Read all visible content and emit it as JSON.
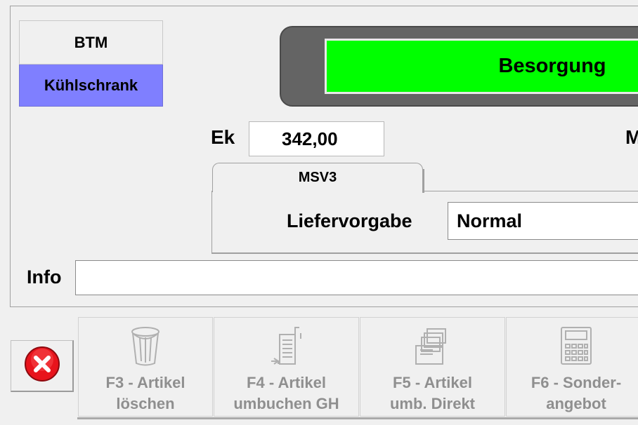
{
  "flags": {
    "btm": "BTM",
    "kuehlschrank": "Kühlschrank"
  },
  "status": {
    "text": "Besorgung",
    "color": "#00ff00"
  },
  "price": {
    "label": "Ek",
    "value": "342,00",
    "next_label_partial": "M"
  },
  "tabs": [
    {
      "label": "MSV3"
    }
  ],
  "msv3": {
    "liefervorgabe_label": "Liefervorgabe",
    "liefervorgabe_value": "Normal"
  },
  "info": {
    "label": "Info",
    "value": ""
  },
  "toolbar": {
    "cancel_icon": "close-circle-icon",
    "buttons": [
      {
        "key": "f3",
        "label": "F3 - Artikel\nlöschen",
        "icon": "trash-icon",
        "enabled": false
      },
      {
        "key": "f4",
        "label": "F4 - Artikel\numbuchen GH",
        "icon": "document-transfer-icon",
        "enabled": false
      },
      {
        "key": "f5",
        "label": "F5 - Artikel\numb. Direkt",
        "icon": "stacked-documents-icon",
        "enabled": false
      },
      {
        "key": "f6",
        "label": "F6 - Sonder-\nangebot",
        "icon": "calculator-icon",
        "enabled": false
      }
    ]
  },
  "colors": {
    "kuehlschrank_bg": "#7f7fff",
    "status_frame": "#646464",
    "disabled_text": "#8f8f8f"
  }
}
